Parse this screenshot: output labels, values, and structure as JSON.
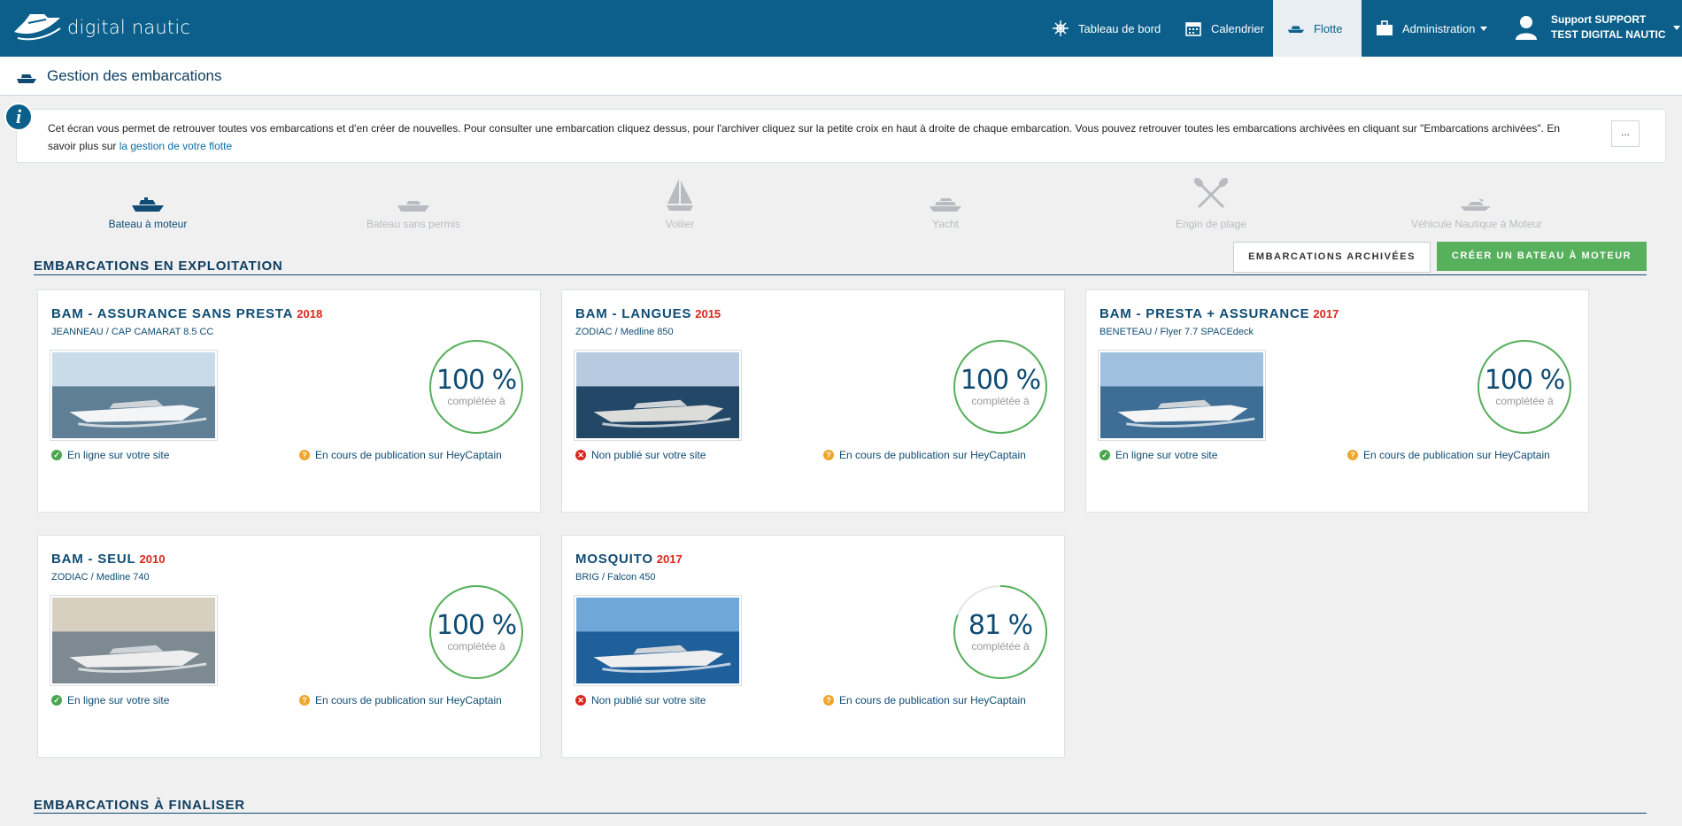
{
  "app": {
    "logo_text": "digital nautic"
  },
  "nav": {
    "dashboard": "Tableau de bord",
    "calendar": "Calendrier",
    "fleet": "Flotte",
    "admin": "Administration",
    "user_line1": "Support SUPPORT",
    "user_line2": "TEST DIGITAL NAUTIC"
  },
  "page": {
    "title": "Gestion des embarcations"
  },
  "info": {
    "text": "Cet écran vous permet de retrouver toutes vos embarcations et d'en créer de nouvelles. Pour consulter une embarcation cliquez dessus, pour l'archiver cliquez sur la petite croix en haut à droite de chaque embarcation. Vous pouvez retrouver toutes les embarcations archivées en cliquant sur \"Embarcations archivées\". En savoir plus sur ",
    "link": "la gestion de votre flotte",
    "more_button": "..."
  },
  "types": [
    {
      "label": "Bateau à moteur",
      "icon": "motorboat-icon",
      "active": true
    },
    {
      "label": "Bateau sans permis",
      "icon": "small-boat-icon",
      "active": false
    },
    {
      "label": "Voilier",
      "icon": "sailboat-icon",
      "active": false
    },
    {
      "label": "Yacht",
      "icon": "yacht-icon",
      "active": false
    },
    {
      "label": "Engin de plage",
      "icon": "paddles-icon",
      "active": false
    },
    {
      "label": "Véhicule Nautique à Moteur",
      "icon": "jetski-icon",
      "active": false
    }
  ],
  "sections": {
    "exploitation": "Embarcations en exploitation",
    "finaliser": "Embarcations à finaliser"
  },
  "buttons": {
    "archives": "EMBARCATIONS ARCHIVÉES",
    "create": "CRÉER UN BATEAU À MOTEUR"
  },
  "gauge_label": "complétée à",
  "cards": [
    {
      "name": "BAM - ASSURANCE SANS PRESTA",
      "year": "2018",
      "model": "JEANNEAU / CAP CAMARAT 8.5 CC",
      "completion": "100 %",
      "completion_fraction": 1.0,
      "site_status": "En ligne sur votre site",
      "site_ok": true,
      "heycaptain": "En cours de publication sur HeyCaptain"
    },
    {
      "name": "BAM - LANGUES",
      "year": "2015",
      "model": "ZODIAC / Medline 850",
      "completion": "100 %",
      "completion_fraction": 1.0,
      "site_status": "Non publié sur votre site",
      "site_ok": false,
      "heycaptain": "En cours de publication sur HeyCaptain"
    },
    {
      "name": "BAM - PRESTA + ASSURANCE",
      "year": "2017",
      "model": "BENETEAU / Flyer 7.7 SPACEdeck",
      "completion": "100 %",
      "completion_fraction": 1.0,
      "site_status": "En ligne sur votre site",
      "site_ok": true,
      "heycaptain": "En cours de publication sur HeyCaptain"
    },
    {
      "name": "BAM - SEUL",
      "year": "2010",
      "model": "ZODIAC / Medline 740",
      "completion": "100 %",
      "completion_fraction": 1.0,
      "site_status": "En ligne sur votre site",
      "site_ok": true,
      "heycaptain": "En cours de publication sur HeyCaptain"
    },
    {
      "name": "MOSQUITO",
      "year": "2017",
      "model": "BRIG / Falcon 450",
      "completion": "81 %",
      "completion_fraction": 0.81,
      "site_status": "Non publié sur votre site",
      "site_ok": false,
      "heycaptain": "En cours de publication sur HeyCaptain"
    }
  ],
  "colors": {
    "primary": "#0b5f8a",
    "success": "#57b05c",
    "danger": "#d9261c",
    "warning": "#f0a52c"
  }
}
